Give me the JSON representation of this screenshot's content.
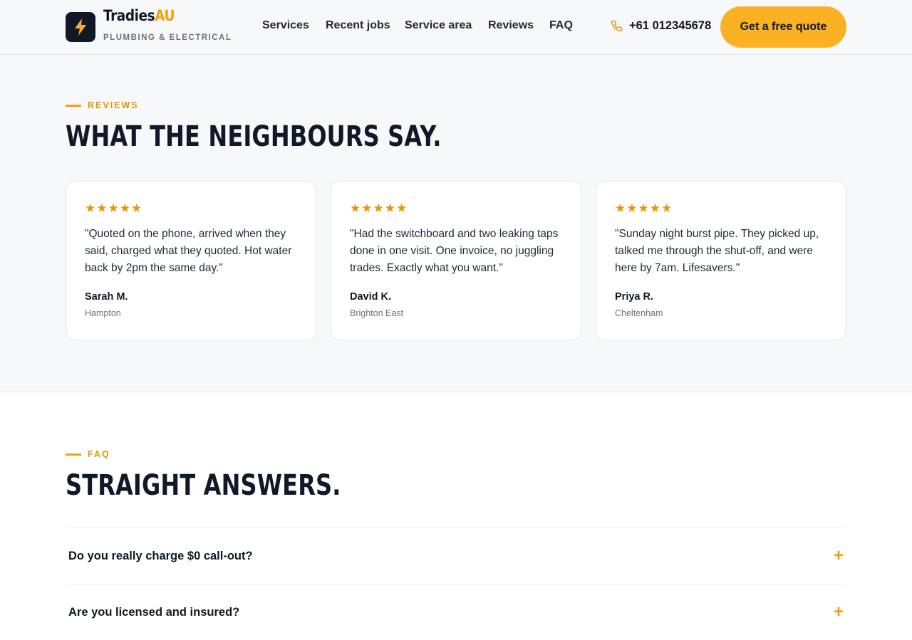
{
  "brand": {
    "name_main": "Tradies",
    "name_accent": "AU",
    "tagline": "PLUMBING & ELECTRICAL",
    "logo_icon": "lightning-bolt-icon"
  },
  "nav": {
    "items": [
      "Services",
      "Recent jobs",
      "Service area",
      "Reviews",
      "FAQ"
    ]
  },
  "contact": {
    "phone_icon": "phone-icon",
    "phone": "+61 012345678",
    "cta_label": "Get a free quote"
  },
  "reviews": {
    "eyebrow": "REVIEWS",
    "title": "WHAT THE NEIGHBOURS SAY.",
    "cards": [
      {
        "rating": 5,
        "quote": "\"Quoted on the phone, arrived when they said, charged what they quoted. Hot water back by 2pm the same day.\"",
        "author": "Sarah M.",
        "location": "Hampton"
      },
      {
        "rating": 5,
        "quote": "\"Had the switchboard and two leaking taps done in one visit. One invoice, no juggling trades. Exactly what you want.\"",
        "author": "David K.",
        "location": "Brighton East"
      },
      {
        "rating": 5,
        "quote": "\"Sunday night burst pipe. They picked up, talked me through the shut-off, and were here by 7am. Lifesavers.\"",
        "author": "Priya R.",
        "location": "Cheltenham"
      }
    ]
  },
  "faq": {
    "eyebrow": "FAQ",
    "title": "STRAIGHT ANSWERS.",
    "items": [
      {
        "question": "Do you really charge $0 call-out?",
        "toggle": "+"
      },
      {
        "question": "Are you licensed and insured?",
        "toggle": "+"
      }
    ]
  },
  "colors": {
    "accent": "#f59e0b",
    "cta_bg": "#fbb124",
    "dark": "#111827",
    "section_bg": "#f7f8fa"
  }
}
